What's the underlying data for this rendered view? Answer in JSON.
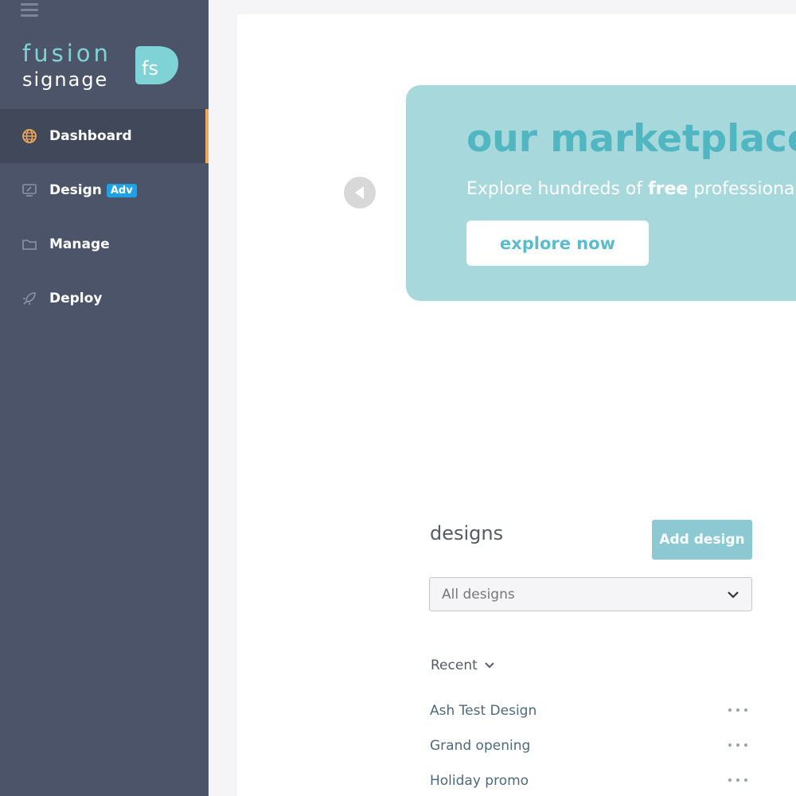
{
  "logo": {
    "word1": "fusion",
    "word2": "signage",
    "mark": "fs"
  },
  "sidebar": {
    "items": [
      {
        "label": "Dashboard",
        "icon": "globe-icon",
        "active": true
      },
      {
        "label": "Design",
        "icon": "design-monitor-icon",
        "badge": "Adv"
      },
      {
        "label": "Manage",
        "icon": "folder-icon"
      },
      {
        "label": "Deploy",
        "icon": "rocket-icon"
      }
    ]
  },
  "banner": {
    "title": "our marketplace",
    "subtitle_pre": "Explore hundreds of ",
    "subtitle_bold": "free",
    "subtitle_post": " professional",
    "button": "explore now"
  },
  "designs": {
    "title": "designs",
    "add_button": "Add design",
    "filter_value": "All designs",
    "recent_label": "Recent",
    "items": [
      "Ash Test Design",
      "Grand opening",
      "Holiday promo"
    ]
  },
  "colors": {
    "sidebar": "#4b5468",
    "accent": "#f2a65a",
    "brand_teal": "#7fd3d7",
    "badge": "#1ea2e6"
  }
}
